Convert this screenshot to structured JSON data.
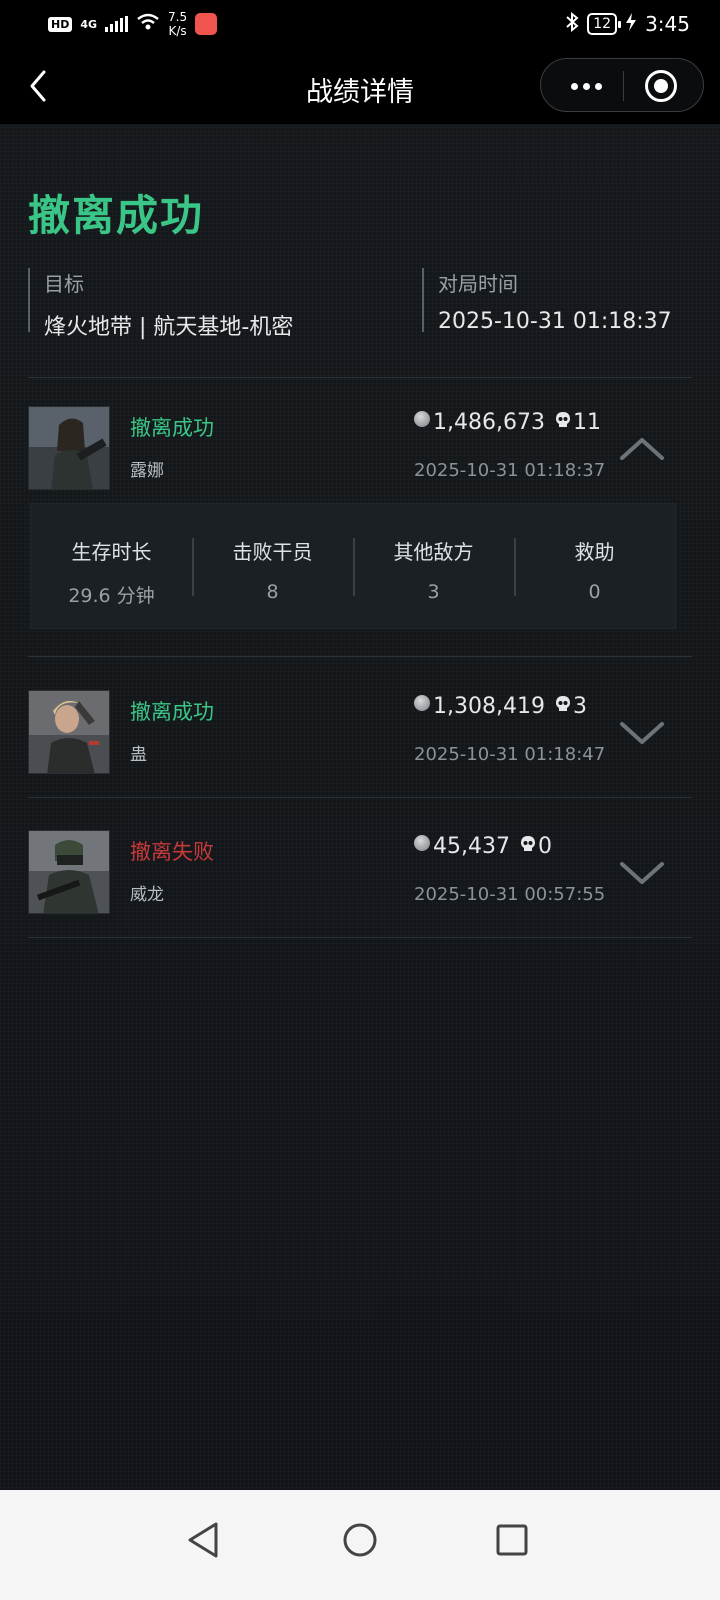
{
  "status_bar": {
    "hd": "HD",
    "network": "4G",
    "speed_value": "7.5",
    "speed_unit": "K/s",
    "battery": "12",
    "time": "3:45"
  },
  "nav": {
    "title": "战绩详情"
  },
  "summary": {
    "result": "撤离成功",
    "target_label": "目标",
    "target_value": "烽火地带 | 航天基地-机密",
    "time_label": "对局时间",
    "time_value": "2025-10-31 01:18:37"
  },
  "players": [
    {
      "status": "撤离成功",
      "status_type": "success",
      "name": "露娜",
      "value": "1,486,673",
      "kills": "11",
      "time": "2025-10-31 01:18:37",
      "expanded": true
    },
    {
      "status": "撤离成功",
      "status_type": "success",
      "name": "蛊",
      "value": "1,308,419",
      "kills": "3",
      "time": "2025-10-31 01:18:47",
      "expanded": false
    },
    {
      "status": "撤离失败",
      "status_type": "failure",
      "name": "威龙",
      "value": "45,437",
      "kills": "0",
      "time": "2025-10-31 00:57:55",
      "expanded": false
    }
  ],
  "details": [
    {
      "label": "生存时长",
      "value": "29.6 分钟"
    },
    {
      "label": "击败干员",
      "value": "8"
    },
    {
      "label": "其他敌方",
      "value": "3"
    },
    {
      "label": "救助",
      "value": "0"
    }
  ],
  "colors": {
    "success": "#3ac686",
    "failure": "#c8393a",
    "background": "#14181b"
  },
  "icons": {
    "coin": "coin-icon",
    "kill": "skull-icon",
    "expand": "chevron-icon"
  }
}
